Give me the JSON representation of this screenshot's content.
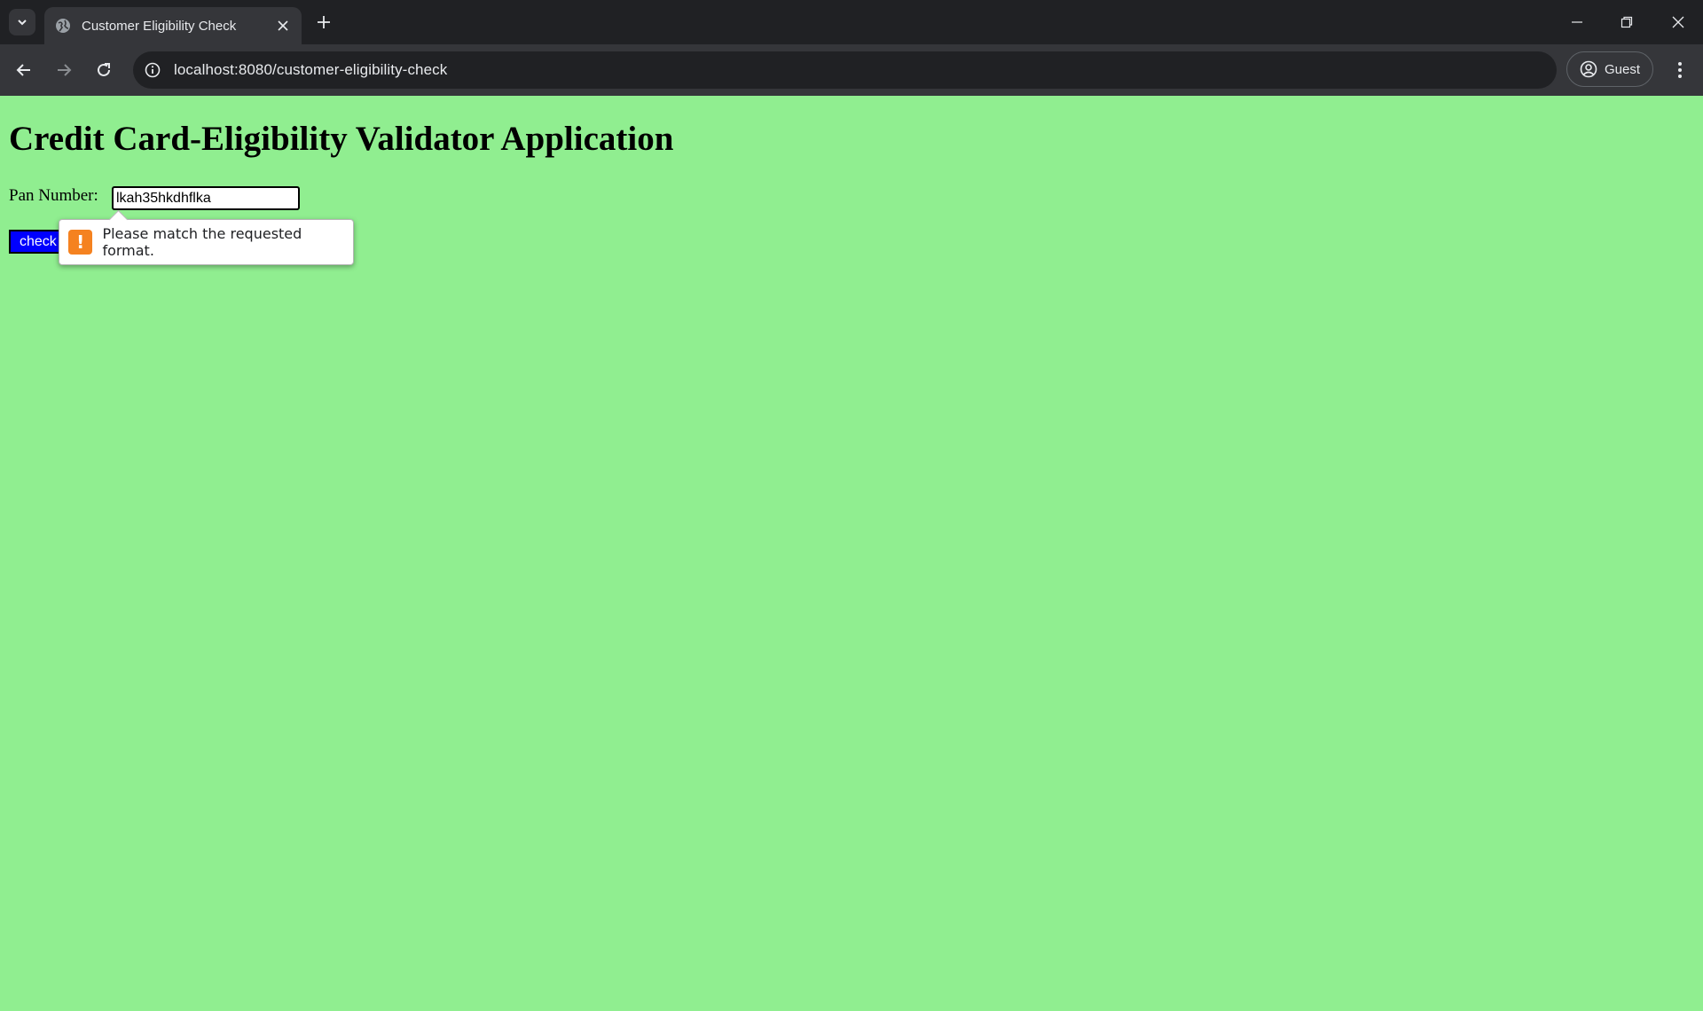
{
  "browser": {
    "tab_title": "Customer Eligibility Check",
    "url": "localhost:8080/customer-eligibility-check",
    "profile_label": "Guest"
  },
  "page": {
    "title": "Credit Card-Eligibility Validator Application",
    "pan_label": "Pan Number:",
    "pan_value": "lkah35hkdhflka",
    "check_button": "check",
    "validation_message": "Please match the requested format."
  },
  "colors": {
    "page_background": "#90ee90",
    "button_background": "#0000ff",
    "warning_icon": "#f58220"
  }
}
